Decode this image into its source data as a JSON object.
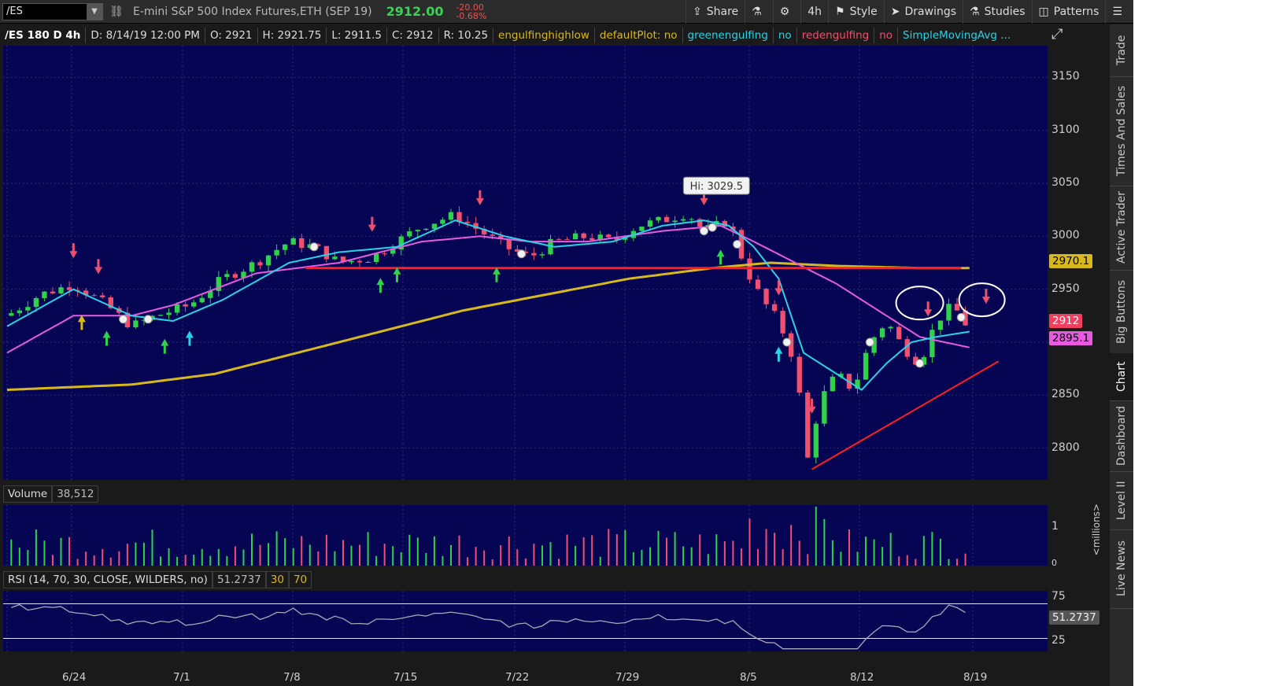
{
  "toolbar": {
    "symbol": "/ES",
    "description": "E-mini S&P 500 Index Futures,ETH (SEP 19)",
    "last_price": "2912.00",
    "change": "-20.00",
    "change_pct": "-0.68%",
    "share": "Share",
    "aggregation": "4h",
    "style": "Style",
    "drawings": "Drawings",
    "studies": "Studies",
    "patterns": "Patterns"
  },
  "header": {
    "title": "/ES 180 D 4h",
    "date": "D: 8/14/19 12:00 PM",
    "open": "O: 2921",
    "high": "H: 2921.75",
    "low": "L: 2911.5",
    "close": "C: 2912",
    "range": "R: 10.25",
    "study1": "engulfinghighlow",
    "study2": "defaultPlot: no",
    "study3": "greenengulfing",
    "study3v": "no",
    "study4": "redengulfing",
    "study4v": "no",
    "study5": "SimpleMovingAvg ..."
  },
  "price_axis": {
    "ticks": [
      "3150",
      "3100",
      "3050",
      "3000",
      "2950",
      "2900",
      "2850",
      "2800"
    ],
    "badge_sma": "2970.1",
    "badge_last": "2912",
    "badge_ma2": "2895.1",
    "hi_label": "Hi: 3029.5"
  },
  "volume": {
    "label": "Volume",
    "value": "38,512",
    "axis_1": "1",
    "axis_0": "0",
    "unit": "<millions>"
  },
  "rsi": {
    "label": "RSI (14, 70, 30, CLOSE, WILDERS, no)",
    "value": "51.2737",
    "lower": "30",
    "upper": "70",
    "axis_75": "75",
    "axis_25": "25",
    "badge": "51.2737"
  },
  "x_axis": [
    "6/24",
    "7/1",
    "7/8",
    "7/15",
    "7/22",
    "7/29",
    "8/5",
    "8/12",
    "8/19"
  ],
  "sidebar": [
    "Trade",
    "Times And Sales",
    "Active Trader",
    "Big Buttons",
    "Chart",
    "Dashboard",
    "Level II",
    "Live News"
  ],
  "colors": {
    "background": "#050553",
    "bull": "#2fd24a",
    "bear": "#f0506e",
    "sma_fast": "#29d3e6",
    "sma_mid": "#e85ae0",
    "sma_slow": "#d8b91c",
    "annotation": "#ff1e1e"
  },
  "chart_data": {
    "type": "line",
    "x_labels": [
      "6/24",
      "7/1",
      "7/8",
      "7/15",
      "7/22",
      "7/29",
      "8/5",
      "8/12",
      "8/19"
    ],
    "ylim": [
      2770,
      3180
    ],
    "close_path": [
      [
        0,
        2925
      ],
      [
        4,
        2945
      ],
      [
        8,
        2955
      ],
      [
        12,
        2935
      ],
      [
        15,
        2915
      ],
      [
        18,
        2925
      ],
      [
        22,
        2935
      ],
      [
        26,
        2960
      ],
      [
        30,
        2975
      ],
      [
        34,
        2995
      ],
      [
        37,
        2990
      ],
      [
        40,
        2975
      ],
      [
        44,
        2980
      ],
      [
        47,
        2995
      ],
      [
        50,
        3010
      ],
      [
        54,
        3020
      ],
      [
        57,
        3005
      ],
      [
        60,
        2990
      ],
      [
        63,
        2980
      ],
      [
        66,
        2995
      ],
      [
        70,
        3000
      ],
      [
        73,
        2995
      ],
      [
        76,
        3010
      ],
      [
        79,
        3015
      ],
      [
        82,
        3022
      ],
      [
        84,
        3005
      ],
      [
        87,
        3015
      ],
      [
        89,
        2970
      ],
      [
        91,
        2940
      ],
      [
        93,
        2920
      ],
      [
        95,
        2880
      ],
      [
        96.5,
        2790
      ],
      [
        98,
        2845
      ],
      [
        100,
        2870
      ],
      [
        102,
        2855
      ],
      [
        104,
        2900
      ],
      [
        106,
        2920
      ],
      [
        108,
        2895
      ],
      [
        110,
        2880
      ],
      [
        112,
        2920
      ],
      [
        114,
        2935
      ],
      [
        116,
        2912
      ]
    ],
    "sma_fast": [
      [
        0,
        2915
      ],
      [
        8,
        2950
      ],
      [
        15,
        2925
      ],
      [
        20,
        2920
      ],
      [
        26,
        2940
      ],
      [
        34,
        2975
      ],
      [
        40,
        2985
      ],
      [
        47,
        2990
      ],
      [
        54,
        3015
      ],
      [
        60,
        3000
      ],
      [
        66,
        2990
      ],
      [
        73,
        2995
      ],
      [
        79,
        3010
      ],
      [
        84,
        3015
      ],
      [
        87,
        3010
      ],
      [
        90,
        2990
      ],
      [
        93,
        2960
      ],
      [
        96,
        2890
      ],
      [
        100,
        2870
      ],
      [
        103,
        2855
      ],
      [
        106,
        2880
      ],
      [
        109,
        2900
      ],
      [
        112,
        2905
      ],
      [
        116,
        2910
      ]
    ],
    "sma_mid": [
      [
        0,
        2890
      ],
      [
        8,
        2925
      ],
      [
        15,
        2925
      ],
      [
        20,
        2935
      ],
      [
        30,
        2965
      ],
      [
        40,
        2975
      ],
      [
        50,
        2995
      ],
      [
        57,
        3000
      ],
      [
        63,
        2995
      ],
      [
        70,
        2995
      ],
      [
        79,
        3005
      ],
      [
        86,
        3010
      ],
      [
        90,
        2995
      ],
      [
        95,
        2975
      ],
      [
        100,
        2955
      ],
      [
        105,
        2930
      ],
      [
        110,
        2905
      ],
      [
        116,
        2895
      ]
    ],
    "sma_slow": [
      [
        0,
        2855
      ],
      [
        15,
        2860
      ],
      [
        25,
        2870
      ],
      [
        35,
        2890
      ],
      [
        45,
        2910
      ],
      [
        55,
        2930
      ],
      [
        65,
        2945
      ],
      [
        75,
        2960
      ],
      [
        85,
        2970
      ],
      [
        92,
        2975
      ],
      [
        100,
        2972
      ],
      [
        110,
        2970
      ],
      [
        116,
        2970
      ]
    ]
  }
}
